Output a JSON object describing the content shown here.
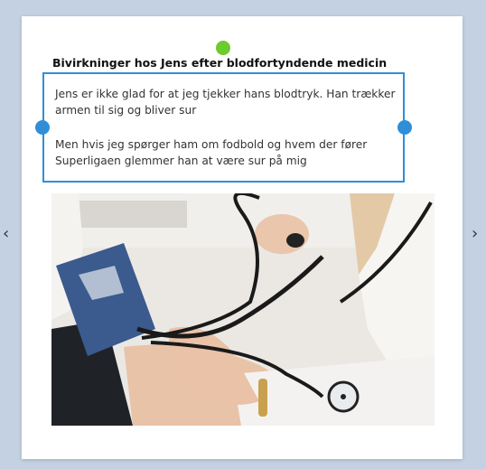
{
  "slide": {
    "title": "Bivirkninger hos Jens efter blodfortyndende medicin",
    "paragraphs": [
      "Jens er ikke glad for at jeg tjekker hans blodtryk. Han trækker armen til sig og bliver sur",
      "Men hvis jeg spørger ham om fodbold og hvem der fører Superligaen glemmer han at være sur på mig"
    ]
  },
  "navigation": {
    "prev_icon": "‹",
    "next_icon": "›"
  },
  "icons": {
    "prev": "chevron-left-icon",
    "next": "chevron-right-icon"
  },
  "colors": {
    "selection": "#2f8ed8",
    "rotate_handle": "#6ccb2d",
    "background": "#c3d1e2"
  }
}
